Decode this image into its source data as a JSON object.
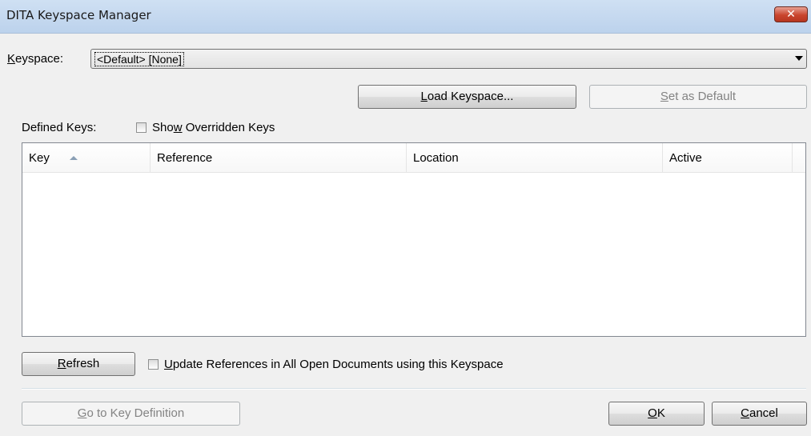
{
  "window": {
    "title": "DITA Keyspace Manager",
    "close_glyph": "✕"
  },
  "keyspace": {
    "label_accel": "K",
    "label_rest": "eyspace:",
    "selected": "<Default> [None]"
  },
  "buttons": {
    "load_accel": "L",
    "load_rest": "oad Keyspace...",
    "set_default_accel": "S",
    "set_default_rest": "et as Default",
    "refresh_accel": "R",
    "refresh_rest": "efresh",
    "goto_accel": "G",
    "goto_rest": "o to Key Definition",
    "ok_accel": "O",
    "ok_rest": "K",
    "cancel_accel": "C",
    "cancel_rest": "ancel"
  },
  "defined_keys_label": "Defined Keys:",
  "show_overridden": {
    "pre": "Sho",
    "accel": "w",
    "post": " Overridden Keys",
    "checked": false
  },
  "table": {
    "columns": [
      "Key",
      "Reference",
      "Location",
      "Active"
    ],
    "sort_column": "Key",
    "sort_direction": "ascending",
    "rows": []
  },
  "update_refs": {
    "accel": "U",
    "rest": "pdate References in All Open Documents using this Keyspace",
    "checked": false
  }
}
